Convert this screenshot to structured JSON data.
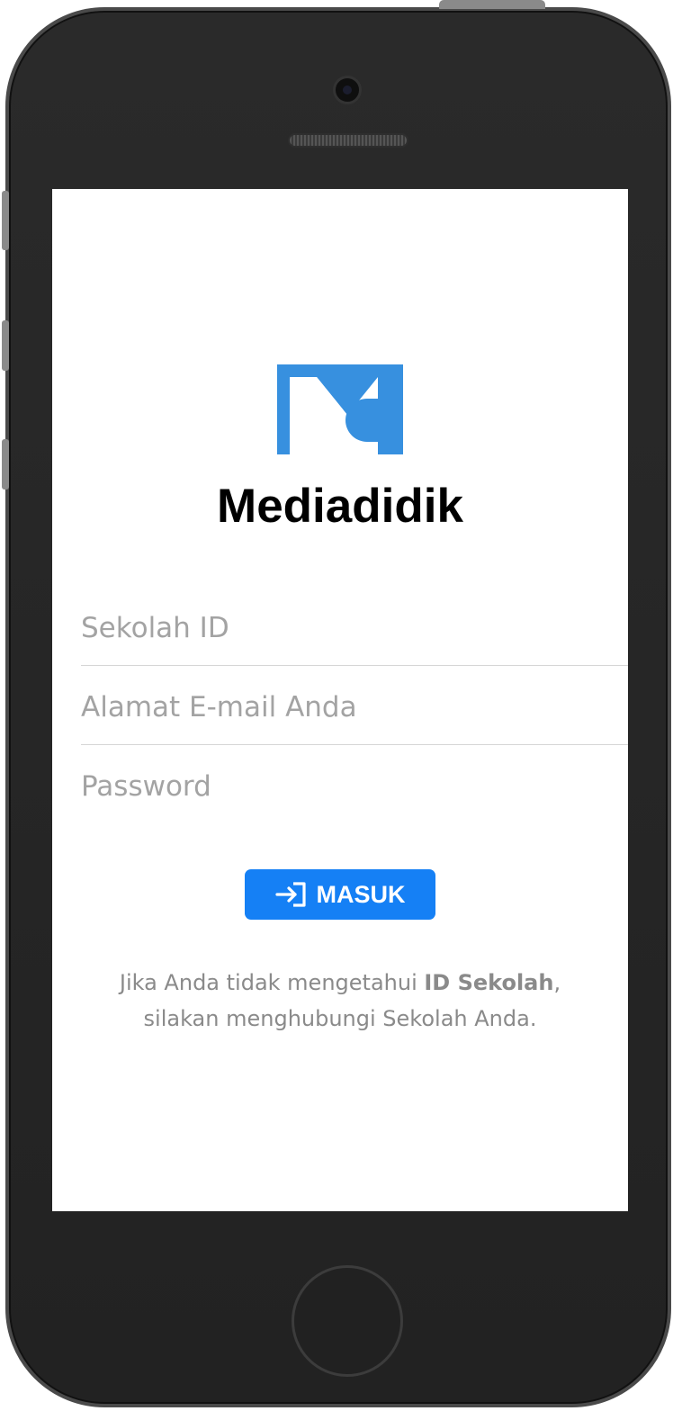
{
  "app": {
    "name": "Mediadidik",
    "brand_color": "#3790df"
  },
  "form": {
    "school_id_placeholder": "Sekolah ID",
    "email_placeholder": "Alamat E-mail Anda",
    "password_placeholder": "Password",
    "submit_label": "MASUK",
    "submit_icon": "login-arrow-icon",
    "submit_color": "#1580f5"
  },
  "help": {
    "line1_prefix": "Jika Anda tidak mengetahui ",
    "line1_bold": "ID Sekolah",
    "line1_suffix": ",",
    "line2": "silakan menghubungi Sekolah Anda."
  }
}
